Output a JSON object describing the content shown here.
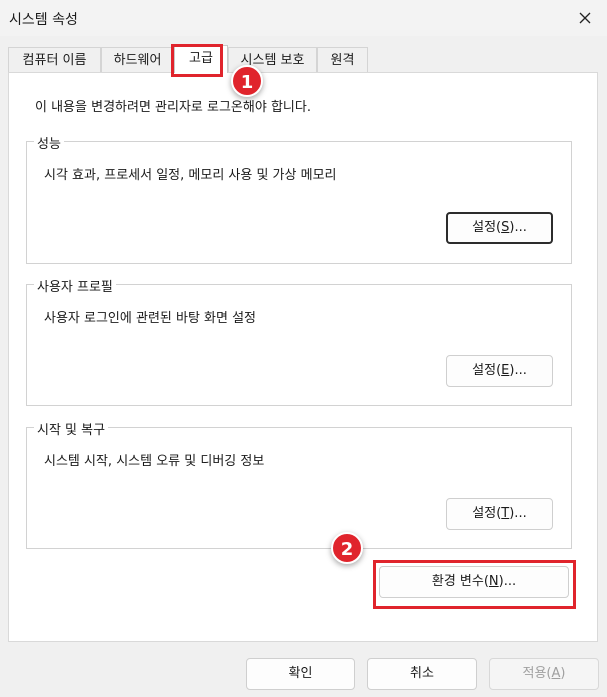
{
  "window": {
    "title": "시스템 속성"
  },
  "tabs": [
    {
      "label": "컴퓨터 이름",
      "active": false
    },
    {
      "label": "하드웨어",
      "active": false
    },
    {
      "label": "고급",
      "active": true
    },
    {
      "label": "시스템 보호",
      "active": false
    },
    {
      "label": "원격",
      "active": false
    }
  ],
  "notice": "이 내용을 변경하려면 관리자로 로그온해야 합니다.",
  "groups": [
    {
      "title": "성능",
      "description": "시각 효과, 프로세서 일정, 메모리 사용 및 가상 메모리",
      "button": {
        "prefix": "설정(",
        "mnemonic": "S",
        "suffix": ")..."
      }
    },
    {
      "title": "사용자 프로필",
      "description": "사용자 로그인에 관련된 바탕 화면 설정",
      "button": {
        "prefix": "설정(",
        "mnemonic": "E",
        "suffix": ")..."
      }
    },
    {
      "title": "시작 및 복구",
      "description": "시스템 시작, 시스템 오류 및 디버깅 정보",
      "button": {
        "prefix": "설정(",
        "mnemonic": "T",
        "suffix": ")..."
      }
    }
  ],
  "env_button": {
    "prefix": "환경 변수(",
    "mnemonic": "N",
    "suffix": ")..."
  },
  "footer": {
    "ok": "확인",
    "cancel": "취소",
    "apply": {
      "prefix": "적용(",
      "mnemonic": "A",
      "suffix": ")"
    }
  },
  "annotations": [
    {
      "number": "1",
      "color": "#e0242c"
    },
    {
      "number": "2",
      "color": "#e0242c"
    }
  ]
}
